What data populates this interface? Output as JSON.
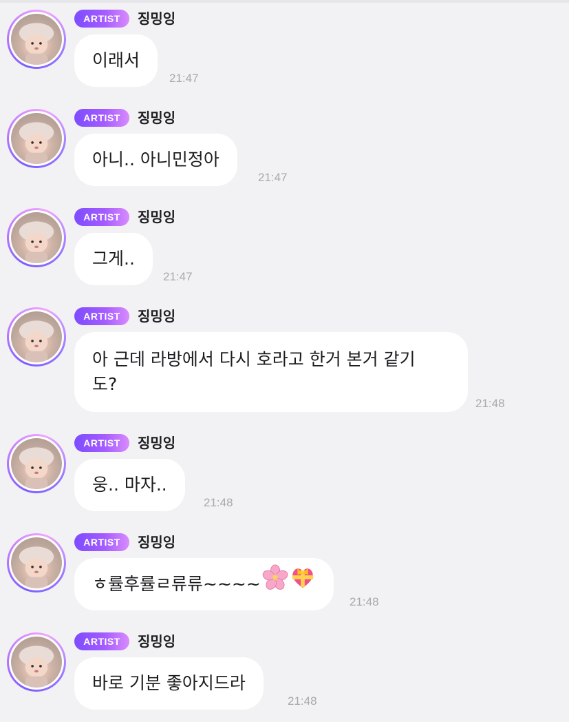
{
  "chat": {
    "messages": [
      {
        "badge": "ARTIST",
        "sender": "징밍잉",
        "text": "이래서",
        "time": "21:47"
      },
      {
        "badge": "ARTIST",
        "sender": "징밍잉",
        "text": "아니.. 아니민정아",
        "time": "21:47"
      },
      {
        "badge": "ARTIST",
        "sender": "징밍잉",
        "text": "그게..",
        "time": "21:47"
      },
      {
        "badge": "ARTIST",
        "sender": "징밍잉",
        "line1": "아 근데 라방에서 다시 호라고 한거 본거 같기",
        "line2": "도?",
        "time": "21:48"
      },
      {
        "badge": "ARTIST",
        "sender": "징밍잉",
        "text": "웅.. 마자..",
        "time": "21:48"
      },
      {
        "badge": "ARTIST",
        "sender": "징밍잉",
        "text": "ㅎ률후률ㄹ류류~~~~",
        "emojis": [
          "cherry-blossom-icon",
          "heart-with-ribbon-icon"
        ],
        "time": "21:48"
      },
      {
        "badge": "ARTIST",
        "sender": "징밍잉",
        "text": "바로 기분 좋아지드라",
        "time": "21:48"
      }
    ]
  },
  "colors": {
    "background": "#f2f2f4",
    "bubble": "#ffffff",
    "badge_start": "#7d4cff",
    "badge_end": "#d98bff",
    "timestamp": "#a8a8ae"
  }
}
